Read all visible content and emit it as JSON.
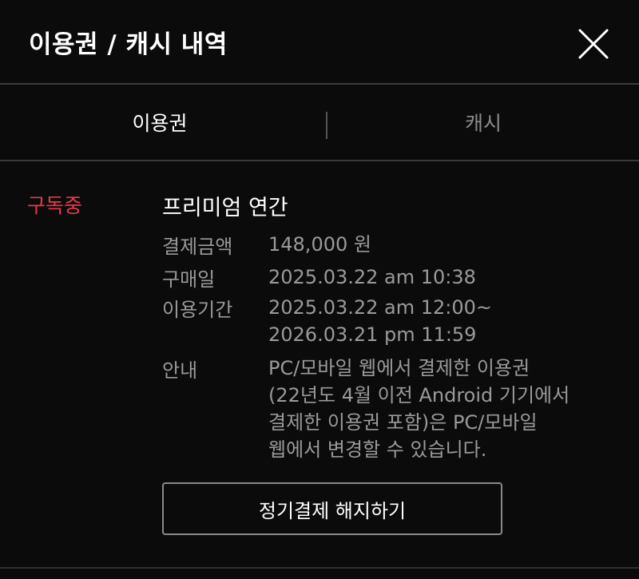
{
  "header": {
    "title": "이용권 / 캐시 내역",
    "close_icon": "close-icon"
  },
  "tabs": [
    {
      "label": "이용권",
      "active": true
    },
    {
      "label": "캐시",
      "active": false
    }
  ],
  "subscription": {
    "status": "구독중",
    "status_color": "#e5394a",
    "product_name": "프리미엄 연간",
    "details": {
      "amount_label": "결제금액",
      "amount_value": "148,000 원",
      "purchase_date_label": "구매일",
      "purchase_date_value": "2025.03.22 am 10:38",
      "period_label": "이용기간",
      "period_start": "2025.03.22 am 12:00~",
      "period_end": "2026.03.21 pm 11:59",
      "notice_label": "안내",
      "notice_lines": [
        "PC/모바일 웹에서 결제한 이용권",
        "(22년도 4월 이전 Android 기기에서",
        "결제한 이용권 포함)은 PC/모바일",
        "웹에서 변경할 수 있습니다."
      ]
    },
    "cancel_button_label": "정기결제 해지하기"
  }
}
